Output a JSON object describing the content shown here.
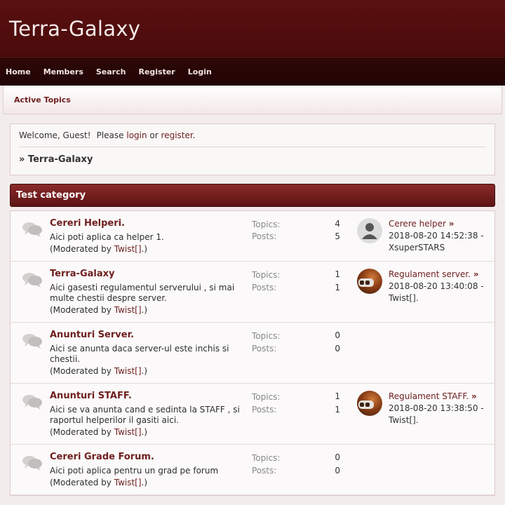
{
  "site": {
    "title": "Terra-Galaxy"
  },
  "nav": {
    "items": [
      {
        "label": "Home"
      },
      {
        "label": "Members"
      },
      {
        "label": "Search"
      },
      {
        "label": "Register"
      },
      {
        "label": "Login"
      }
    ]
  },
  "subnav": {
    "active_topics": "Active Topics"
  },
  "welcome": {
    "prefix": "Welcome, Guest!",
    "please": "Please",
    "login": "login",
    "or": "or",
    "register": "register",
    "period": ".",
    "breadcrumb": "» Terra-Galaxy"
  },
  "category": {
    "name": "Test category"
  },
  "labels": {
    "topics": "Topics:",
    "posts": "Posts:",
    "moderated_by": "(Moderated by",
    "moderator_suffix": ".)"
  },
  "forums": [
    {
      "title": "Cereri Helperi.",
      "desc": "Aici poti aplica ca helper 1.",
      "moderator": "Twist[]",
      "topics": "4",
      "posts": "5",
      "last_title": "Cerere helper",
      "last_date": "2018-08-20 14:52:38 -",
      "last_user": "XsuperSTARS",
      "avatar": "default-avatar"
    },
    {
      "title": "Terra-Galaxy",
      "desc": "Aici gasesti regulamentul serverului , si mai multe chestii despre server.",
      "moderator": "Twist[]",
      "topics": "1",
      "posts": "1",
      "last_title": "Regulament server.",
      "last_date": "2018-08-20 13:40:08 -",
      "last_user": "Twist[].",
      "avatar": "photo-avatar"
    },
    {
      "title": "Anunturi Server.",
      "desc": "Aici se anunta daca server-ul este inchis si chestii.",
      "moderator": "Twist[]",
      "topics": "0",
      "posts": "0",
      "last_title": "",
      "last_date": "",
      "last_user": "",
      "avatar": ""
    },
    {
      "title": "Anunturi STAFF.",
      "desc": "Aici se va anunta cand e sedinta la STAFF , si raportul helperilor il gasiti aici.",
      "moderator": "Twist[]",
      "topics": "1",
      "posts": "1",
      "last_title": "Regulament STAFF.",
      "last_date": "2018-08-20 13:38:50 -",
      "last_user": "Twist[].",
      "avatar": "photo-avatar"
    },
    {
      "title": "Cereri Grade Forum.",
      "desc": "Aici poti aplica pentru un grad pe forum",
      "moderator": "Twist[]",
      "topics": "0",
      "posts": "0",
      "last_title": "",
      "last_date": "",
      "last_user": "",
      "avatar": ""
    }
  ],
  "colors": {
    "header_bg": "#4f0d0d",
    "nav_bg": "#260606",
    "accent_link": "#6e1e1e",
    "category_bar": "#6e1c1c",
    "page_bg": "#f3ecec"
  }
}
